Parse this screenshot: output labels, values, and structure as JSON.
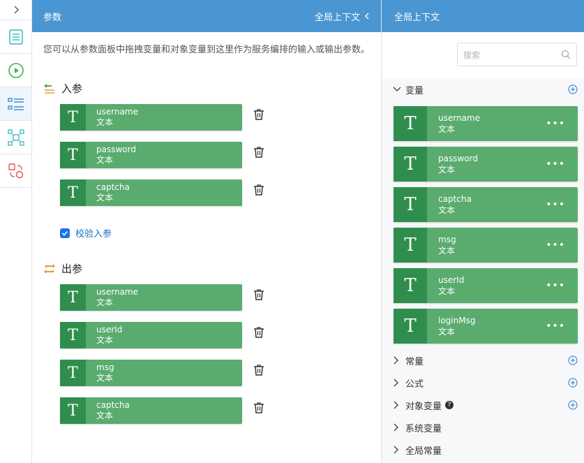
{
  "params_panel": {
    "title": "参数",
    "global_ctx_link": "全局上下文",
    "description": "您可以从参数面板中拖拽变量和对象变量到这里作为服务编排的输入或输出参数。",
    "input_section": {
      "title": "入参",
      "items": [
        {
          "name": "username",
          "type": "文本"
        },
        {
          "name": "password",
          "type": "文本"
        },
        {
          "name": "captcha",
          "type": "文本"
        }
      ],
      "validate_label": "校验入参",
      "validate_checked": true
    },
    "output_section": {
      "title": "出参",
      "items": [
        {
          "name": "username",
          "type": "文本"
        },
        {
          "name": "userId",
          "type": "文本"
        },
        {
          "name": "msg",
          "type": "文本"
        },
        {
          "name": "captcha",
          "type": "文本"
        }
      ]
    }
  },
  "context_panel": {
    "title": "全局上下文",
    "search_placeholder": "搜索",
    "variables_group": {
      "label": "变量",
      "items": [
        {
          "name": "username",
          "type": "文本"
        },
        {
          "name": "password",
          "type": "文本"
        },
        {
          "name": "captcha",
          "type": "文本"
        },
        {
          "name": "msg",
          "type": "文本"
        },
        {
          "name": "userId",
          "type": "文本"
        },
        {
          "name": "loginMsg",
          "type": "文本"
        }
      ]
    },
    "groups": [
      {
        "label": "常量",
        "has_add": true
      },
      {
        "label": "公式",
        "has_add": true
      },
      {
        "label": "对象变量",
        "has_add": true,
        "has_help": true
      },
      {
        "label": "系统变量",
        "has_add": false
      },
      {
        "label": "全局常量",
        "has_add": false
      }
    ],
    "more_glyph": "•••"
  },
  "type_glyph": "T",
  "colors": {
    "header": "#4a96d2",
    "card": "#5aab6e",
    "card_dark": "#2f8e4e",
    "accent": "#1a73e8"
  }
}
